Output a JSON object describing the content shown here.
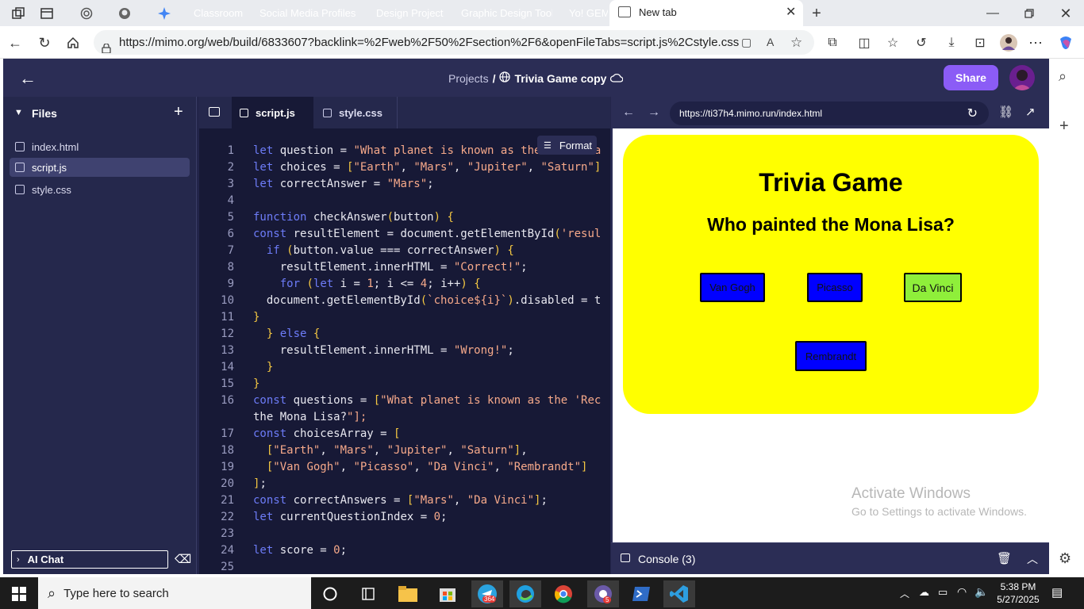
{
  "browser": {
    "tabs": [
      {
        "label": "Classroom",
        "color": "#e8710a"
      },
      {
        "label": "Social Media Profiles &",
        "color": "#e91e8c"
      },
      {
        "label": "Design Projects",
        "color": "#1a73e8"
      },
      {
        "label": "Graphic Design Tools",
        "color": "#12857a"
      },
      {
        "label": "Yo! GEM",
        "color": "#c81e9e"
      }
    ],
    "active_tab": "New tab",
    "url": "https://mimo.org/web/build/6833607?backlink=%2Fweb%2F50%2Fsection%2F6&openFileTabs=script.js%2Cstyle.css"
  },
  "app": {
    "breadcrumb_projects": "Projects",
    "separator": "/",
    "project_title": "Trivia Game copy",
    "share_label": "Share",
    "files_heading": "Files",
    "files": [
      "index.html",
      "script.js",
      "style.css"
    ],
    "active_file": "script.js",
    "ai_chat_label": "AI Chat",
    "editor_tabs": [
      "script.js",
      "style.css"
    ],
    "format_label": "Format",
    "preview_url": "https://ti37h4.mimo.run/index.html",
    "console_label": "Console (3)"
  },
  "code_lines": [
    {
      "n": "1",
      "text": "let question = \"What planet is known as the 'Red Pla"
    },
    {
      "n": "2",
      "text": "let choices = [\"Earth\", \"Mars\", \"Jupiter\", \"Saturn\"]"
    },
    {
      "n": "3",
      "text": "let correctAnswer = \"Mars\";"
    },
    {
      "n": "4",
      "text": ""
    },
    {
      "n": "5",
      "text": "function checkAnswer(button) {"
    },
    {
      "n": "6",
      "text": "const resultElement = document.getElementById('resul"
    },
    {
      "n": "7",
      "text": "  if (button.value === correctAnswer) {"
    },
    {
      "n": "8",
      "text": "    resultElement.innerHTML = \"Correct!\";"
    },
    {
      "n": "9",
      "text": "    for (let i = 1; i <= 4; i++) {"
    },
    {
      "n": "10",
      "text": "  document.getElementById(`choice${i}`).disabled = t"
    },
    {
      "n": "11",
      "text": "}"
    },
    {
      "n": "12",
      "text": "  } else {"
    },
    {
      "n": "13",
      "text": "    resultElement.innerHTML = \"Wrong!\";"
    },
    {
      "n": "14",
      "text": "  }"
    },
    {
      "n": "15",
      "text": "}"
    },
    {
      "n": "16",
      "text": "const questions = [\"What planet is known as the 'Rec"
    },
    {
      "n": "",
      "text": "the Mona Lisa?\"];"
    },
    {
      "n": "17",
      "text": "const choicesArray = ["
    },
    {
      "n": "18",
      "text": "  [\"Earth\", \"Mars\", \"Jupiter\", \"Saturn\"],"
    },
    {
      "n": "19",
      "text": "  [\"Van Gogh\", \"Picasso\", \"Da Vinci\", \"Rembrandt\"]"
    },
    {
      "n": "20",
      "text": "];"
    },
    {
      "n": "21",
      "text": "const correctAnswers = [\"Mars\", \"Da Vinci\"];"
    },
    {
      "n": "22",
      "text": "let currentQuestionIndex = 0;"
    },
    {
      "n": "23",
      "text": ""
    },
    {
      "n": "24",
      "text": "let score = 0;"
    },
    {
      "n": "25",
      "text": ""
    }
  ],
  "game": {
    "title": "Trivia Game",
    "question": "Who painted the Mona Lisa?",
    "choices": [
      "Van Gogh",
      "Picasso",
      "Da Vinci",
      "Rembrandt"
    ],
    "highlighted_choice": "Da Vinci",
    "card_color": "#ffff00",
    "button_color": "#0000ff",
    "correct_color": "#8fef3a"
  },
  "watermark": {
    "line1": "Activate Windows",
    "line2": "Go to Settings to activate Windows."
  },
  "taskbar": {
    "search_placeholder": "Type here to search",
    "time": "5:38 PM",
    "date": "5/27/2025",
    "telegram_badge": "364",
    "chrome_badge": "5"
  },
  "colors": {
    "share": "#8b5cf6",
    "selected_file": "#3f4270"
  }
}
